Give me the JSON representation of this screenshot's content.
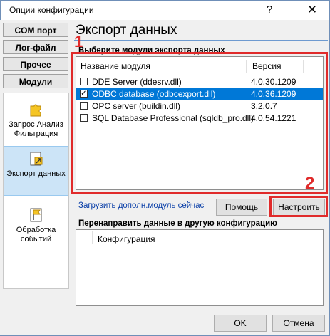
{
  "window": {
    "title": "Опции конфигурации",
    "help_glyph": "?",
    "close_glyph": "✕"
  },
  "categories": [
    {
      "label": "COM порт"
    },
    {
      "label": "Лог-файл"
    },
    {
      "label": "Прочее"
    },
    {
      "label": "Модули"
    }
  ],
  "modules": [
    {
      "label": "Запрос Анализ Фильтрация",
      "icon": "puzzle-icon",
      "selected": false
    },
    {
      "label": "Экспорт данных",
      "icon": "export-icon",
      "selected": true
    },
    {
      "label": "Обработка событий",
      "icon": "flag-icon",
      "selected": false
    }
  ],
  "main": {
    "heading": "Экспорт данных",
    "section_label": "Выберите модули экспорта данных",
    "columns": {
      "name": "Название модуля",
      "version": "Версия"
    },
    "rows": [
      {
        "checked": false,
        "name": "DDE Server (ddesrv.dll)",
        "version": "4.0.30.1209",
        "selected": false
      },
      {
        "checked": true,
        "name": "ODBC database (odbcexport.dll)",
        "version": "4.0.36.1209",
        "selected": true
      },
      {
        "checked": false,
        "name": "OPC server (buildin.dll)",
        "version": "3.2.0.7",
        "selected": false
      },
      {
        "checked": false,
        "name": "SQL Database Professional (sqldb_pro.dll)",
        "version": "4.0.54.1221",
        "selected": false
      }
    ],
    "link_text": "Загрузить дополн.модуль сейчас",
    "help_button": "Помощь",
    "configure_button": "Настроить",
    "redirect_label": "Перенаправить данные в другую конфигурацию",
    "config_column": "Конфигурация"
  },
  "annotations": {
    "one": "1",
    "two": "2",
    "color": "#e02b2b"
  },
  "footer": {
    "ok_button": "OK",
    "cancel_button": "Отмена"
  }
}
